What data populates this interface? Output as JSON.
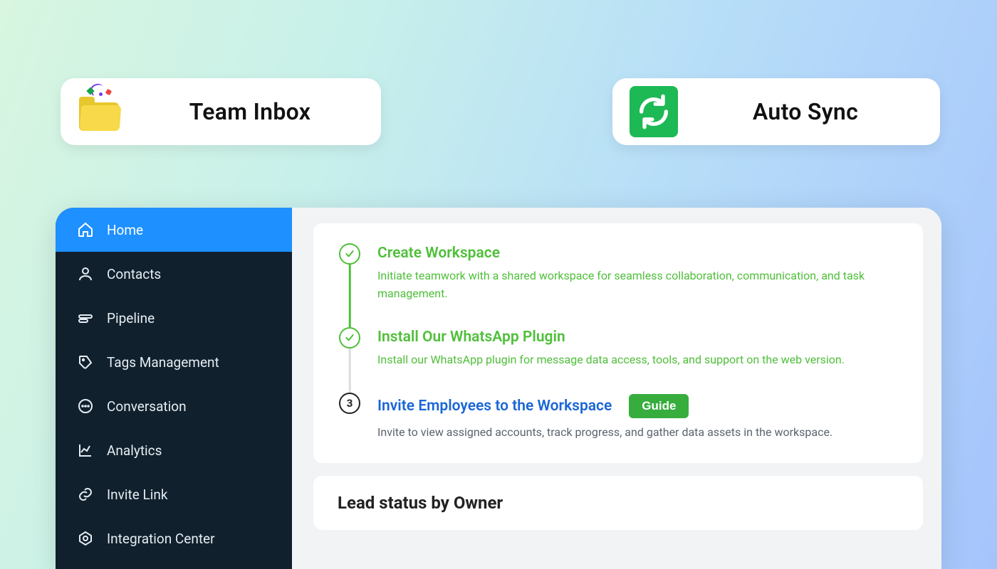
{
  "features": {
    "team_inbox": "Team Inbox",
    "auto_sync": "Auto Sync"
  },
  "sidebar": {
    "items": [
      {
        "label": "Home"
      },
      {
        "label": "Contacts"
      },
      {
        "label": "Pipeline"
      },
      {
        "label": "Tags Management"
      },
      {
        "label": "Conversation"
      },
      {
        "label": "Analytics"
      },
      {
        "label": "Invite Link"
      },
      {
        "label": "Integration Center"
      }
    ]
  },
  "onboarding": {
    "steps": [
      {
        "title": "Create Workspace",
        "desc": "Initiate teamwork with a shared workspace for seamless collaboration, communication, and task management.",
        "done": true
      },
      {
        "title": "Install Our WhatsApp Plugin",
        "desc": "Install our WhatsApp plugin for message data access, tools, and support on the web version.",
        "done": true
      },
      {
        "title": "Invite Employees to the Workspace",
        "desc": "Invite to view assigned accounts, track progress, and gather data assets in the workspace.",
        "number": "3",
        "guide_label": "Guide"
      }
    ]
  },
  "section2": {
    "title": "Lead status by Owner"
  },
  "colors": {
    "accent_blue": "#1e90ff",
    "success_green": "#4fbf3a",
    "cta_green": "#37ad3d",
    "danger_red": "#ef2f3a",
    "sidebar_bg": "#11202d"
  }
}
